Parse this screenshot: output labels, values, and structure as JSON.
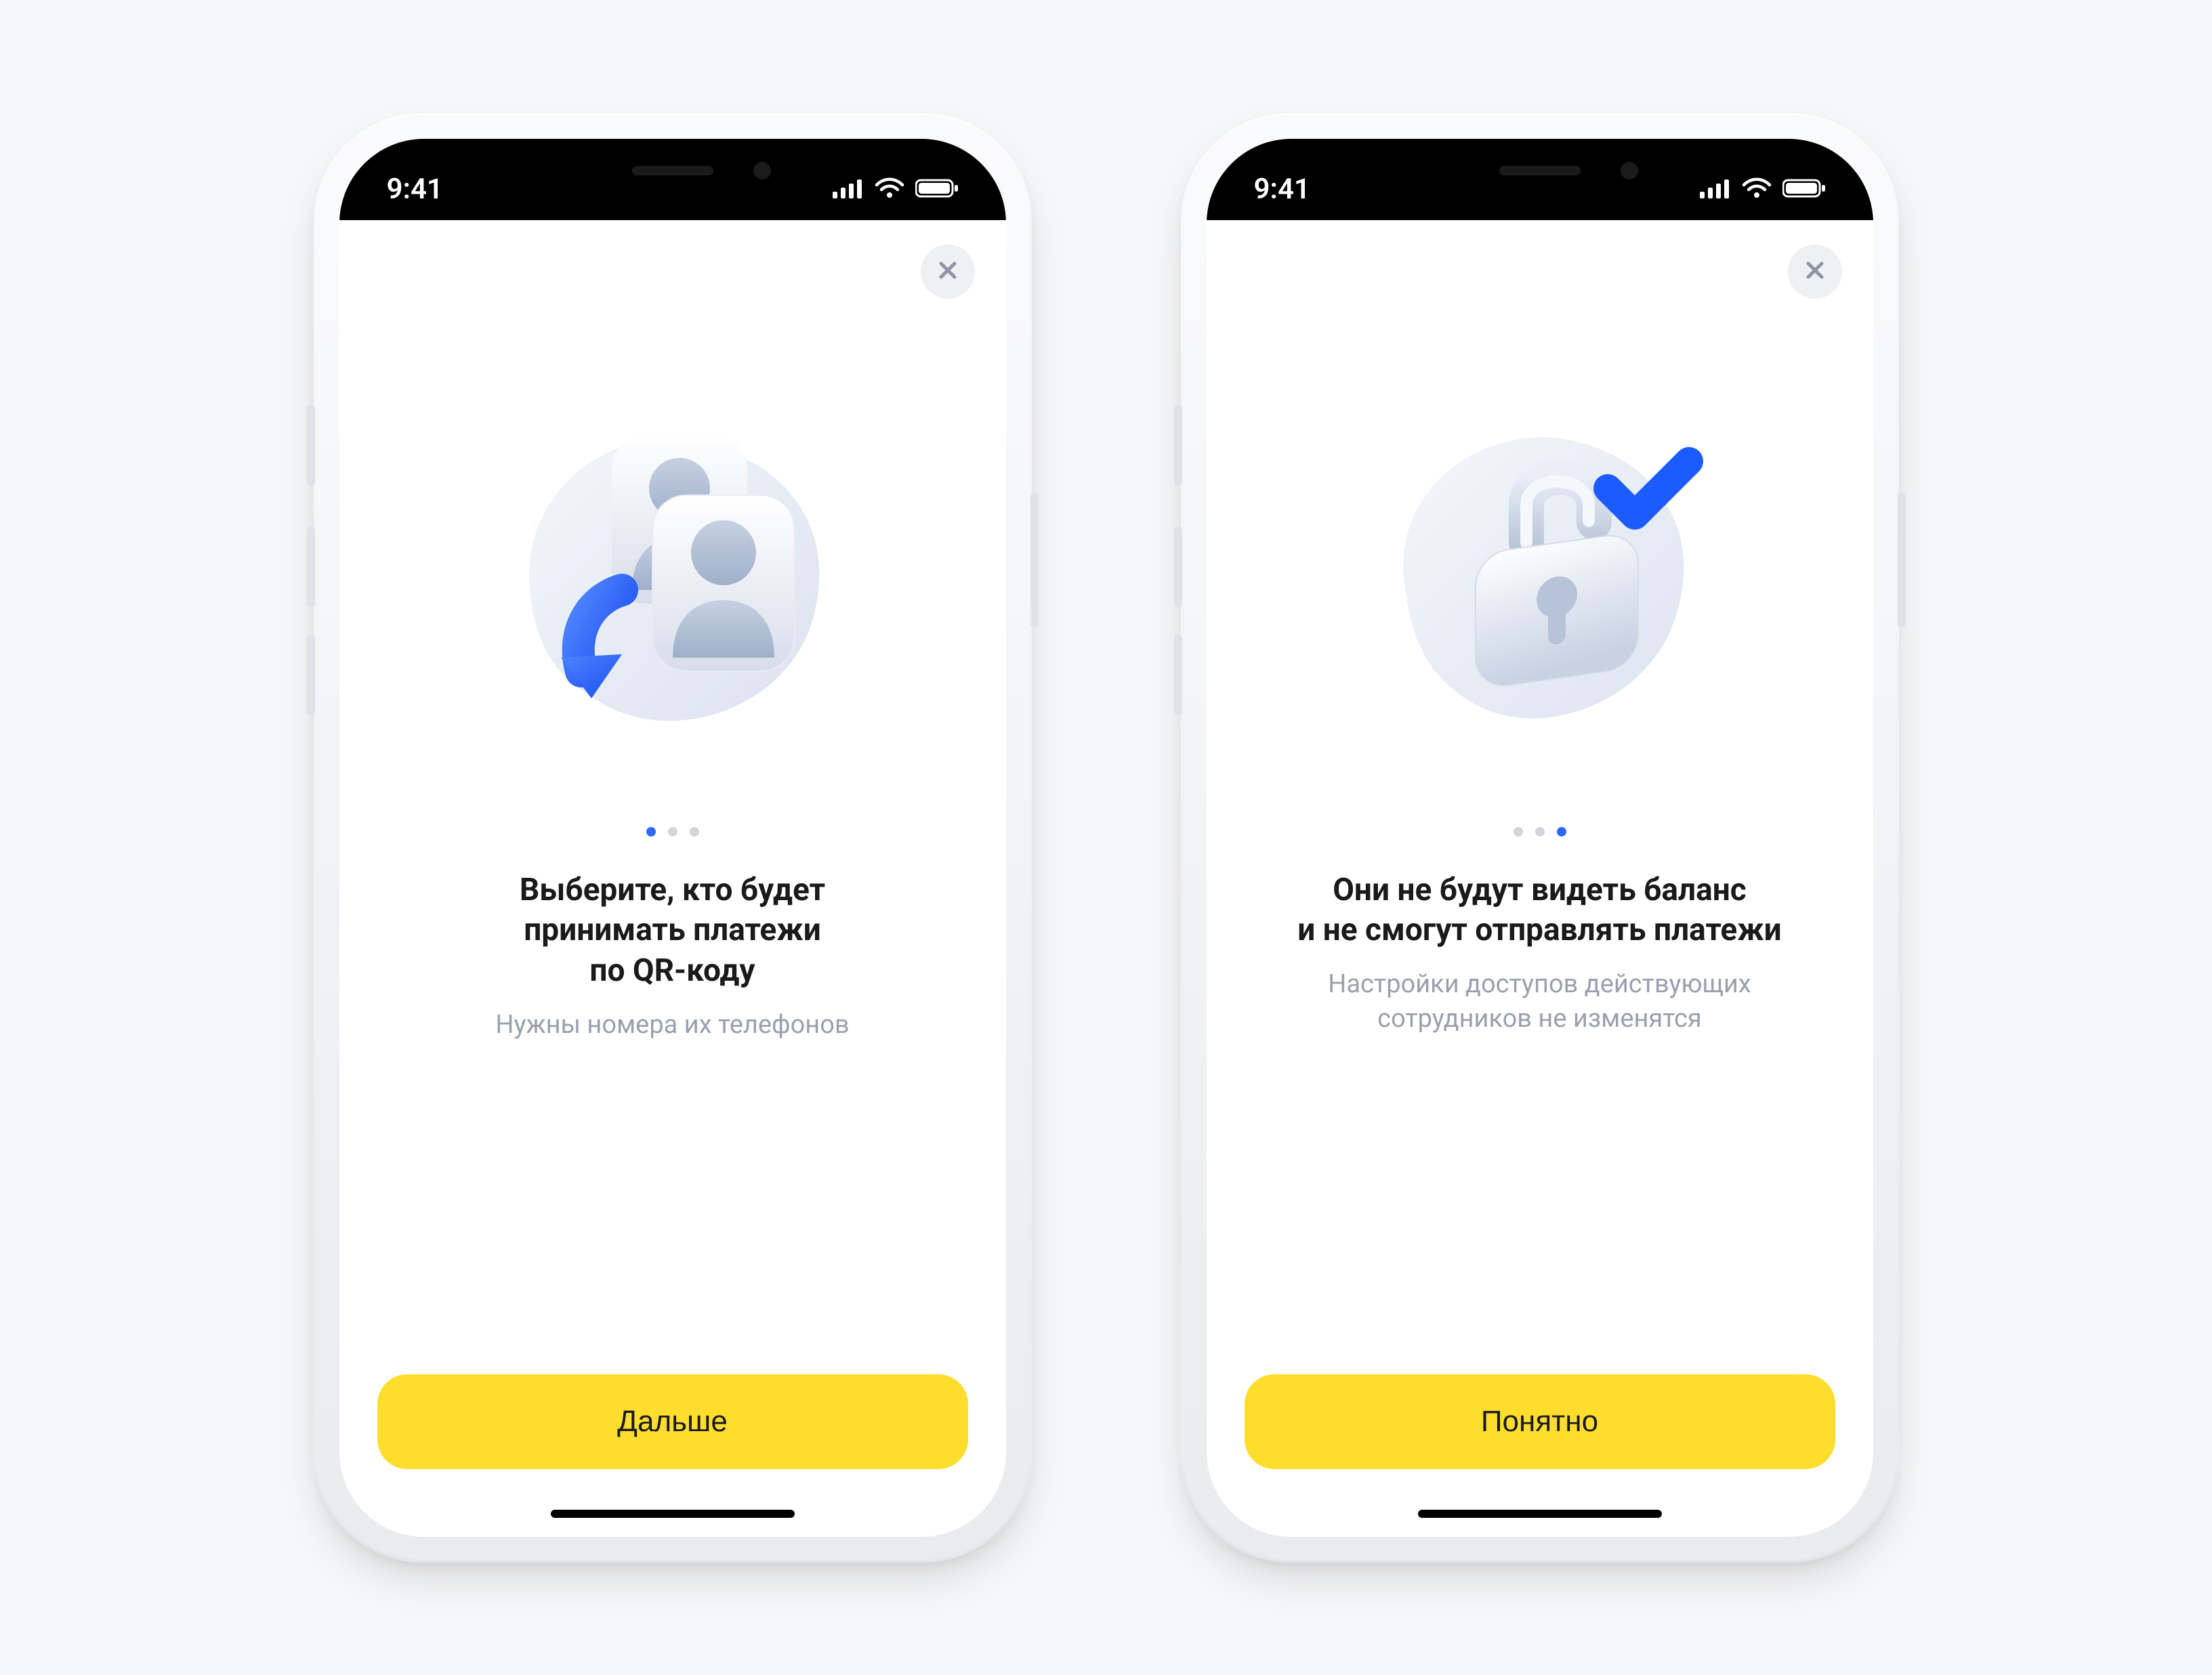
{
  "status": {
    "time": "9:41"
  },
  "colors": {
    "accent": "#2f68ff",
    "cta": "#ffdd2d",
    "text": "#1a1a1a",
    "subtext": "#9aa1ae"
  },
  "screens": [
    {
      "icon": "people-transfer-icon",
      "activeDot": 0,
      "title": "Выберите, кто будет\nпринимать платежи\nпо QR-коду",
      "subtitle": "Нужны номера их телефонов",
      "cta": "Дальше"
    },
    {
      "icon": "lock-check-icon",
      "activeDot": 2,
      "title": "Они не будут видеть баланс\nи не смогут отправлять платежи",
      "subtitle": "Настройки доступов действующих\nсотрудников не изменятся",
      "cta": "Понятно"
    }
  ]
}
